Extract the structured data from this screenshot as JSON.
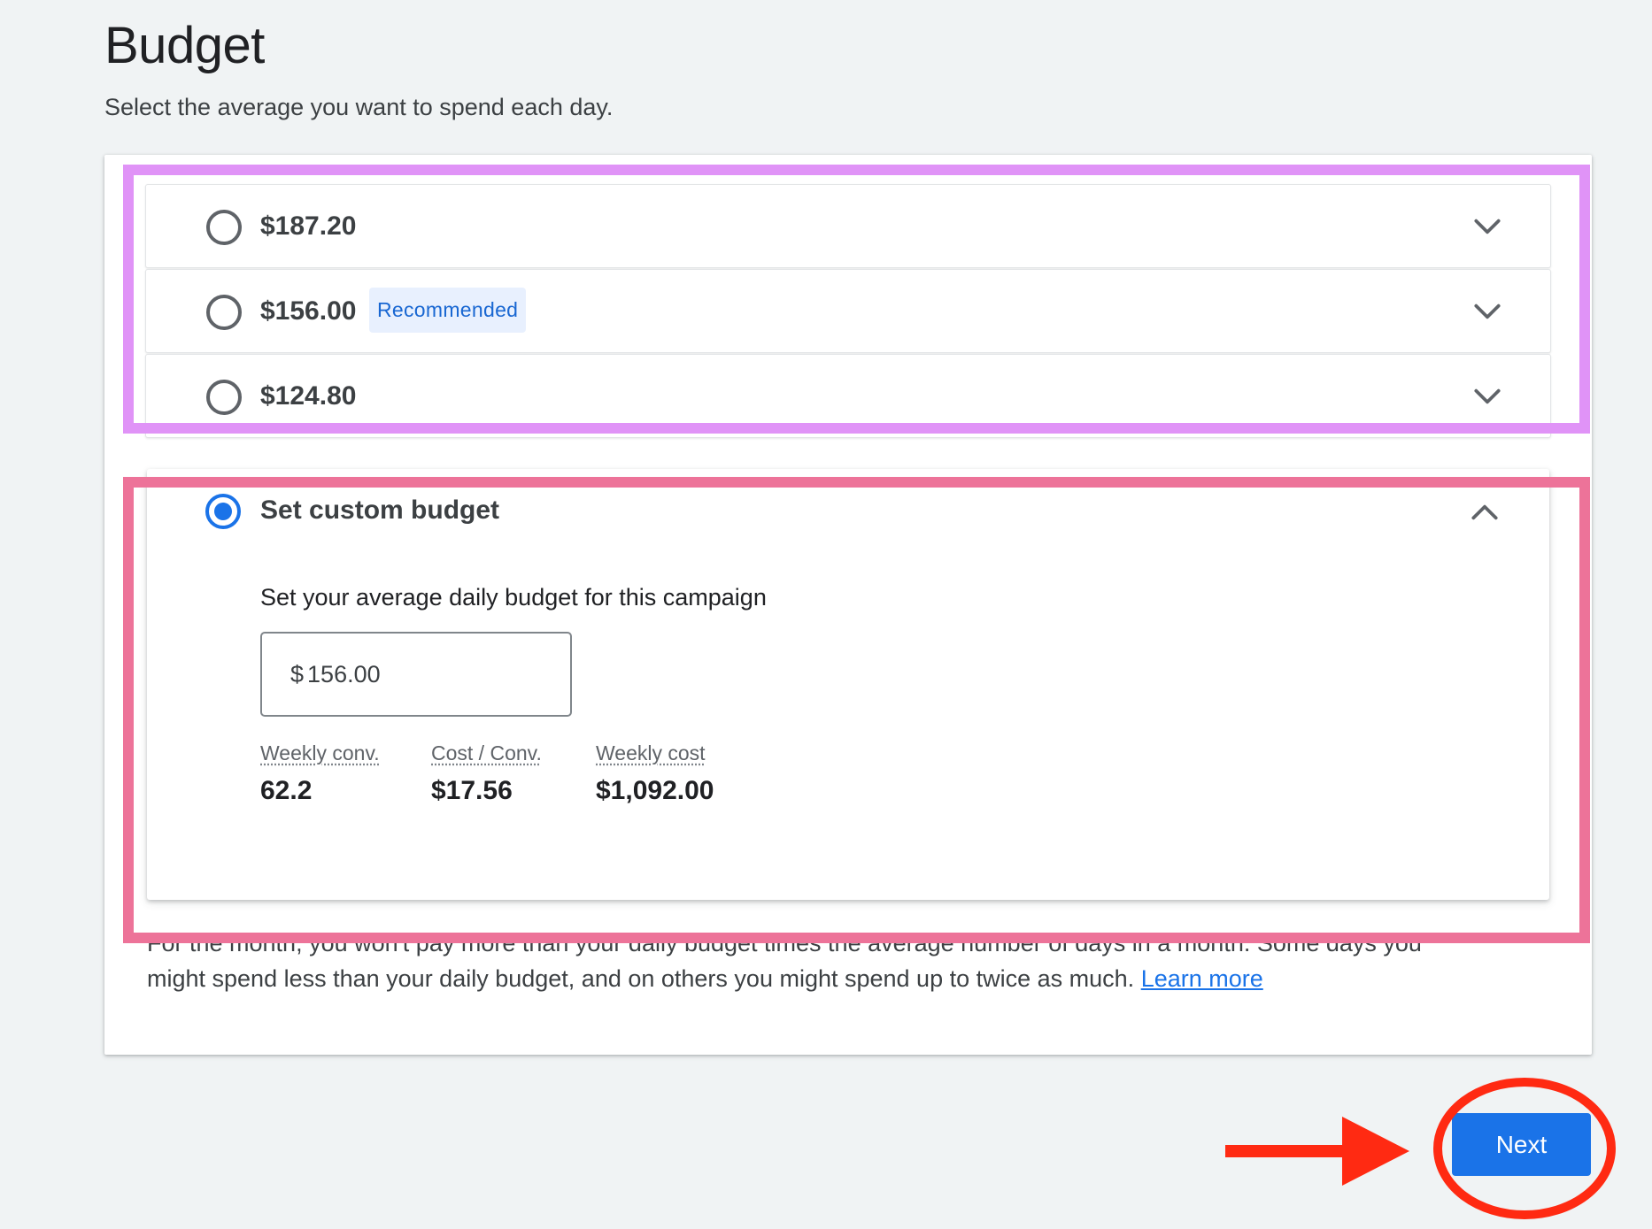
{
  "header": {
    "title": "Budget",
    "subtitle": "Select the average you want to spend each day."
  },
  "budget_options": [
    {
      "amount": "$187.20",
      "badge": ""
    },
    {
      "amount": "$156.00",
      "badge": "Recommended"
    },
    {
      "amount": "$124.80",
      "badge": ""
    }
  ],
  "custom": {
    "label": "Set custom budget",
    "description": "Set your average daily budget for this campaign",
    "input": {
      "currency": "$",
      "value": "156.00"
    },
    "metrics": [
      {
        "label": "Weekly conv.",
        "value": "62.2"
      },
      {
        "label": "Cost / Conv.",
        "value": "$17.56"
      },
      {
        "label": "Weekly cost",
        "value": "$1,092.00"
      }
    ]
  },
  "footnote": {
    "line1": "For the month, you won't pay more than your daily budget times the average number of days in a month. Some days you",
    "line2": "might spend less than your daily budget, and on others you might spend up to twice as much.",
    "link": "Learn more"
  },
  "actions": {
    "next_label": "Next"
  },
  "icons": {
    "option_expand": "chevron-down-icon",
    "custom_collapse": "chevron-up-icon",
    "pointer_arrow": "arrow-right-icon"
  },
  "colors": {
    "accent": "#1a73e8",
    "badge_bg": "#e8f0fe",
    "badge_text": "#1967d2",
    "annotation_purple": "#e093f7",
    "annotation_pink": "#ed7399",
    "annotation_red": "#ff2a12"
  }
}
